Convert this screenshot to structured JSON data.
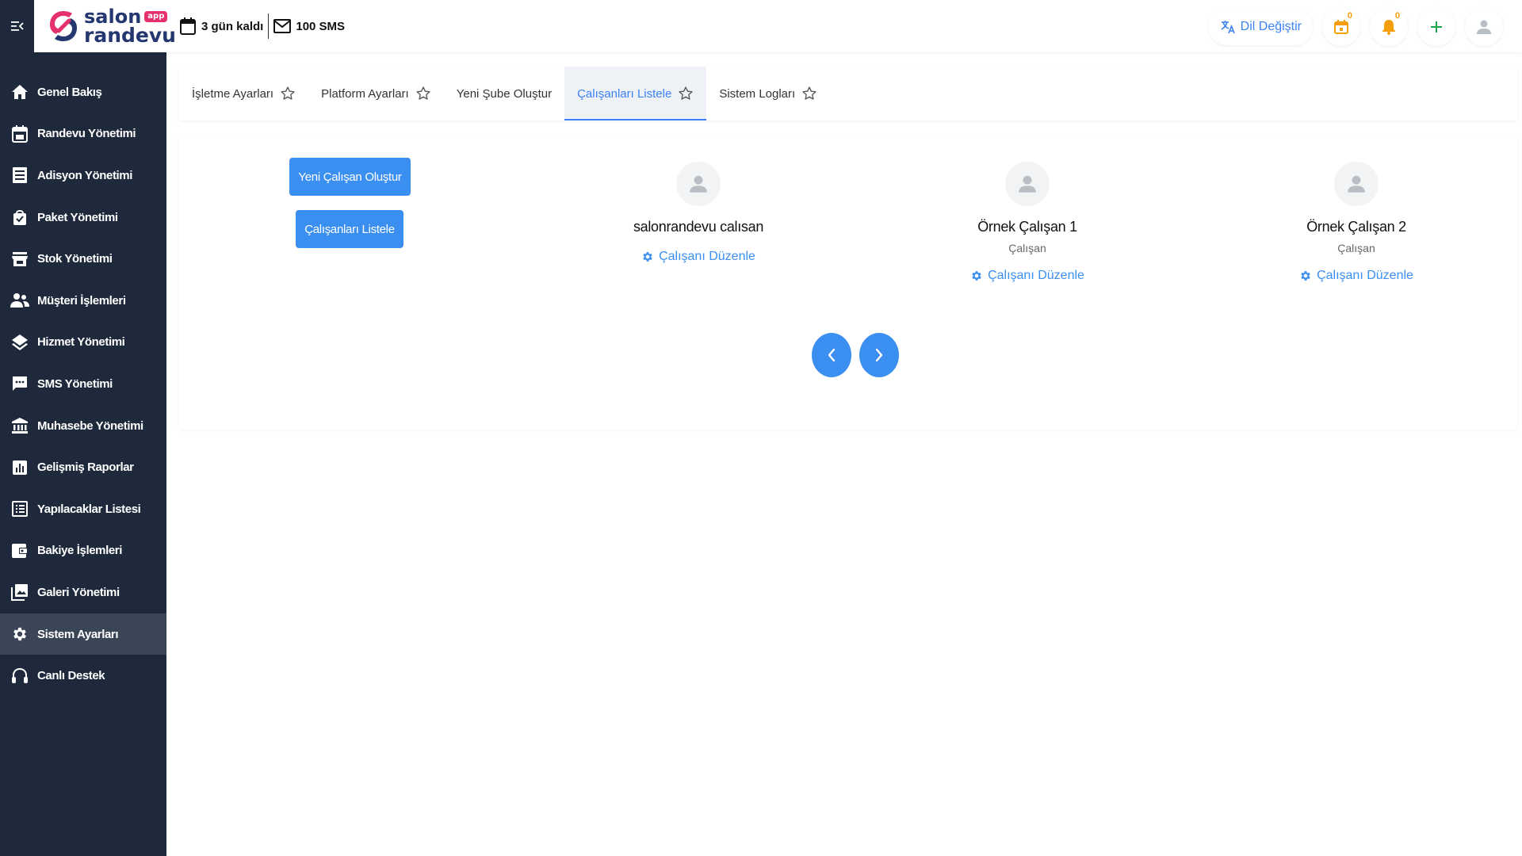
{
  "header": {
    "logo": {
      "line1": "salon",
      "badge": "app",
      "line2": "randevu"
    },
    "days_left": "3 gün kaldı",
    "sms": "100 SMS",
    "lang_label": "Dil Değiştir",
    "calendar_count": "0",
    "notification_count": "0"
  },
  "sidebar": {
    "items": [
      {
        "label": "Genel Bakış",
        "icon": "home-icon"
      },
      {
        "label": "Randevu Yönetimi",
        "icon": "calendar-icon"
      },
      {
        "label": "Adisyon Yönetimi",
        "icon": "receipt-icon"
      },
      {
        "label": "Paket Yönetimi",
        "icon": "bag-icon"
      },
      {
        "label": "Stok Yönetimi",
        "icon": "store-icon"
      },
      {
        "label": "Müşteri İşlemleri",
        "icon": "users-icon"
      },
      {
        "label": "Hizmet Yönetimi",
        "icon": "layers-icon"
      },
      {
        "label": "SMS Yönetimi",
        "icon": "chat-icon"
      },
      {
        "label": "Muhasebe Yönetimi",
        "icon": "bank-icon"
      },
      {
        "label": "Gelişmiş Raporlar",
        "icon": "chart-icon"
      },
      {
        "label": "Yapılacaklar Listesi",
        "icon": "list-icon"
      },
      {
        "label": "Bakiye İşlemleri",
        "icon": "wallet-icon"
      },
      {
        "label": "Galeri Yönetimi",
        "icon": "gallery-icon"
      },
      {
        "label": "Sistem Ayarları",
        "icon": "gear-icon",
        "active": true
      },
      {
        "label": "Canlı Destek",
        "icon": "headset-icon"
      }
    ]
  },
  "tabs": [
    {
      "label": "İşletme Ayarları",
      "star": true
    },
    {
      "label": "Platform Ayarları",
      "star": true
    },
    {
      "label": "Yeni Şube Oluştur",
      "star": false
    },
    {
      "label": "Çalışanları Listele",
      "star": true,
      "active": true
    },
    {
      "label": "Sistem Logları",
      "star": true
    }
  ],
  "actions": {
    "new_employee": "Yeni Çalışan Oluştur",
    "list_employees": "Çalışanları Listele"
  },
  "employees": [
    {
      "name": "salonrandevu calısan",
      "role": "",
      "edit_label": "Çalışanı Düzenle"
    },
    {
      "name": "Örnek Çalışan 1",
      "role": "Çalışan",
      "edit_label": "Çalışanı Düzenle"
    },
    {
      "name": "Örnek Çalışan 2",
      "role": "Çalışan",
      "edit_label": "Çalışanı Düzenle"
    }
  ],
  "colors": {
    "sidebar_bg": "#1e2a3b",
    "primary": "#3b8ff0",
    "active_nav": "#3a4556",
    "badge": "#f59e0b",
    "plus": "#16a34a",
    "brand_pink": "#e5316b",
    "brand_navy": "#243770"
  }
}
